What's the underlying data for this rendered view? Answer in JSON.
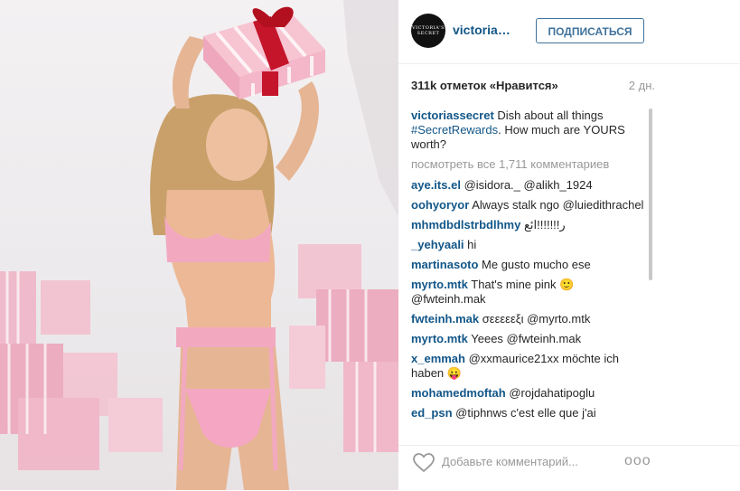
{
  "post": {
    "image_alt": "Model in pink lingerie holding a striped gift box on her head",
    "header": {
      "avatar_text": "VICTORIA'S SECRET",
      "username": "victoriasse…",
      "follow_label": "ПОДПИСАТЬСЯ"
    },
    "likes": "311k отметок «Нравится»",
    "time": "2 дн.",
    "caption": {
      "user": "victoriassecret",
      "text_pre": " Dish about all things ",
      "hashtag": "#SecretRewards",
      "text_post": ". How much are YOURS worth?"
    },
    "view_all": "посмотреть все 1,711 комментариев",
    "comments": [
      {
        "user": "aye.its.el",
        "text": "@isidora._ @alikh_1924"
      },
      {
        "user": "oohyoryor",
        "text": "Always stalk ngo @luiedithrachel"
      },
      {
        "user": "mhmdbdlstrbdlhmy",
        "text": "ر!!!!!!!ائع"
      },
      {
        "user": "_yehyaali",
        "text": "hi"
      },
      {
        "user": "martinasoto",
        "text": "Me gusto mucho ese"
      },
      {
        "user": "myrto.mtk",
        "text": "That's mine pink 🙂 @fwteinh.mak"
      },
      {
        "user": "fwteinh.mak",
        "text": "σεεεεεξι @myrto.mtk"
      },
      {
        "user": "myrto.mtk",
        "text": "Yeees @fwteinh.mak"
      },
      {
        "user": "x_emmah",
        "text": "@xxmaurice21xx möchte ich haben 😛"
      },
      {
        "user": "mohamedmoftah",
        "text": "@rojdahatipoglu"
      },
      {
        "user": "ed_psn",
        "text": "@tiphnws c'est elle que j'ai"
      }
    ],
    "add_comment_placeholder": "Добавьте комментарий...",
    "more_label": "ooo"
  },
  "colors": {
    "link": "#125688",
    "follow": "#3f729b",
    "muted": "#999999",
    "pink": "#f2a9c0"
  },
  "icons": {
    "like": "heart-icon",
    "options": "more-options-icon"
  }
}
